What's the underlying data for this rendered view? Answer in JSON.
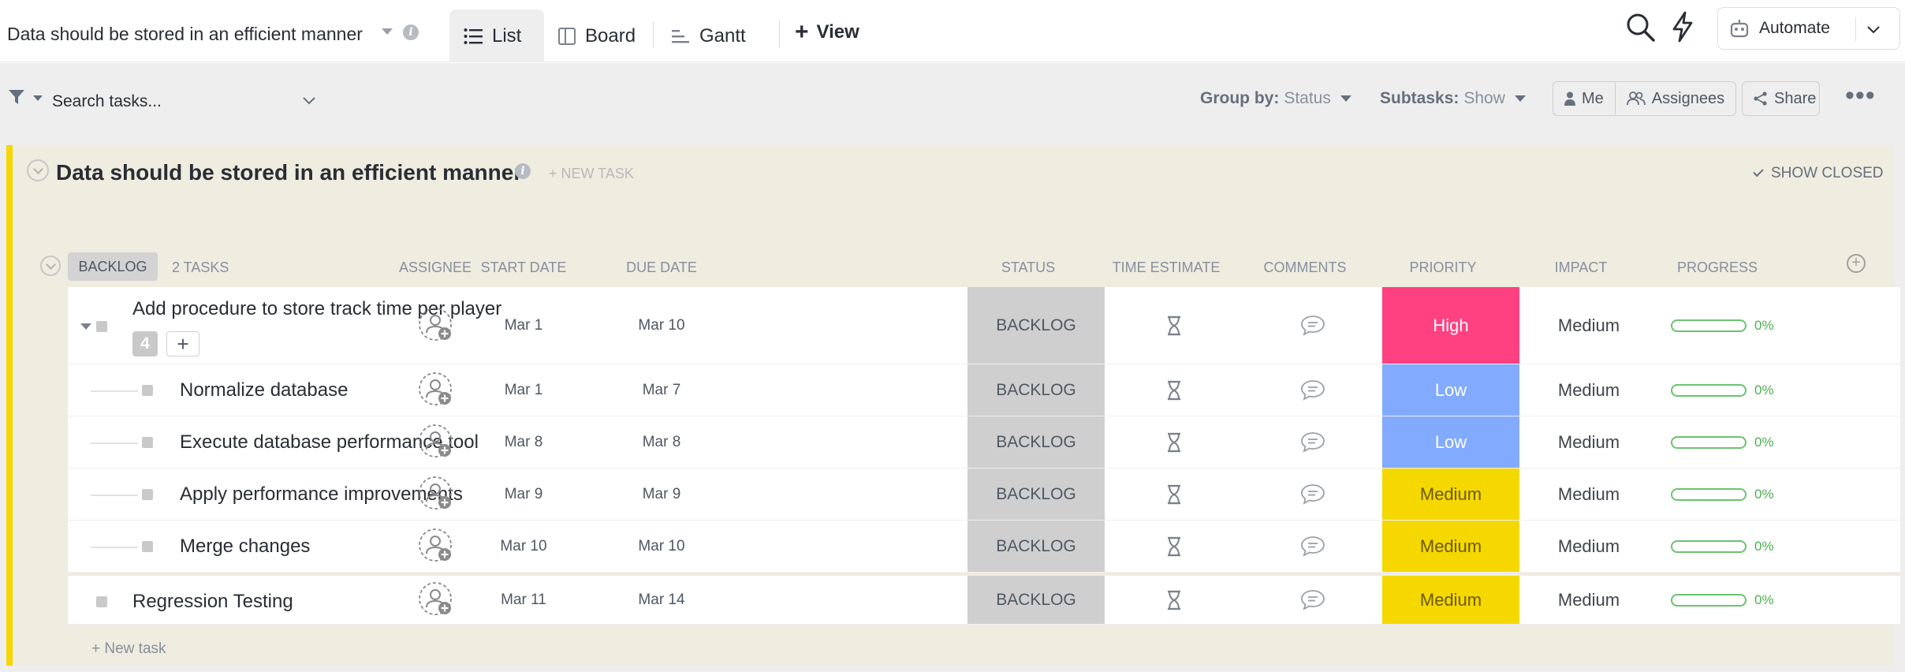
{
  "header": {
    "list_title": "Data should be stored in an efficient manner",
    "tabs": [
      {
        "label": "List",
        "active": true
      },
      {
        "label": "Board",
        "active": false
      },
      {
        "label": "Gantt",
        "active": false
      }
    ],
    "add_view_label": "View",
    "automate_label": "Automate"
  },
  "toolbar": {
    "search_placeholder": "Search tasks...",
    "group_by_label": "Group by:",
    "group_by_value": "Status",
    "subtasks_label": "Subtasks:",
    "subtasks_value": "Show",
    "me_label": "Me",
    "assignees_label": "Assignees",
    "share_label": "Share",
    "more_label": "•••"
  },
  "list": {
    "name": "Data should be stored in an efficient manner",
    "new_task_label": "+ NEW TASK",
    "show_closed_label": "SHOW CLOSED",
    "group_status": "BACKLOG",
    "group_count": "2 TASKS",
    "columns": [
      "ASSIGNEE",
      "START DATE",
      "DUE DATE",
      "STATUS",
      "TIME ESTIMATE",
      "COMMENTS",
      "PRIORITY",
      "IMPACT",
      "PROGRESS"
    ],
    "add_column_label": "+",
    "footer_new_task": "+ New task"
  },
  "colors": {
    "list_accent": "#f5d800",
    "priority_high": "#ff4081",
    "priority_low": "#82aaff",
    "priority_medium": "#f5d800",
    "status_backlog": "#cfcfcf",
    "progress": "#6bc36f"
  },
  "tasks": [
    {
      "name": "Add procedure to store track time per player",
      "subtask_count": "4",
      "start": "Mar 1",
      "due": "Mar 10",
      "status": "BACKLOG",
      "priority": "High",
      "impact": "Medium",
      "progress": "0%",
      "progress_value": 0
    },
    {
      "name": "Normalize database",
      "start": "Mar 1",
      "due": "Mar 7",
      "status": "BACKLOG",
      "priority": "Low",
      "impact": "Medium",
      "progress": "0%",
      "progress_value": 0
    },
    {
      "name": "Execute database performance tool",
      "start": "Mar 8",
      "due": "Mar 8",
      "status": "BACKLOG",
      "priority": "Low",
      "impact": "Medium",
      "progress": "0%",
      "progress_value": 0
    },
    {
      "name": "Apply performance improvements",
      "start": "Mar 9",
      "due": "Mar 9",
      "status": "BACKLOG",
      "priority": "Medium",
      "impact": "Medium",
      "progress": "0%",
      "progress_value": 0
    },
    {
      "name": "Merge changes",
      "start": "Mar 10",
      "due": "Mar 10",
      "status": "BACKLOG",
      "priority": "Medium",
      "impact": "Medium",
      "progress": "0%",
      "progress_value": 0
    },
    {
      "name": "Regression Testing",
      "start": "Mar 11",
      "due": "Mar 14",
      "status": "BACKLOG",
      "priority": "Medium",
      "impact": "Medium",
      "progress": "0%",
      "progress_value": 0
    }
  ]
}
